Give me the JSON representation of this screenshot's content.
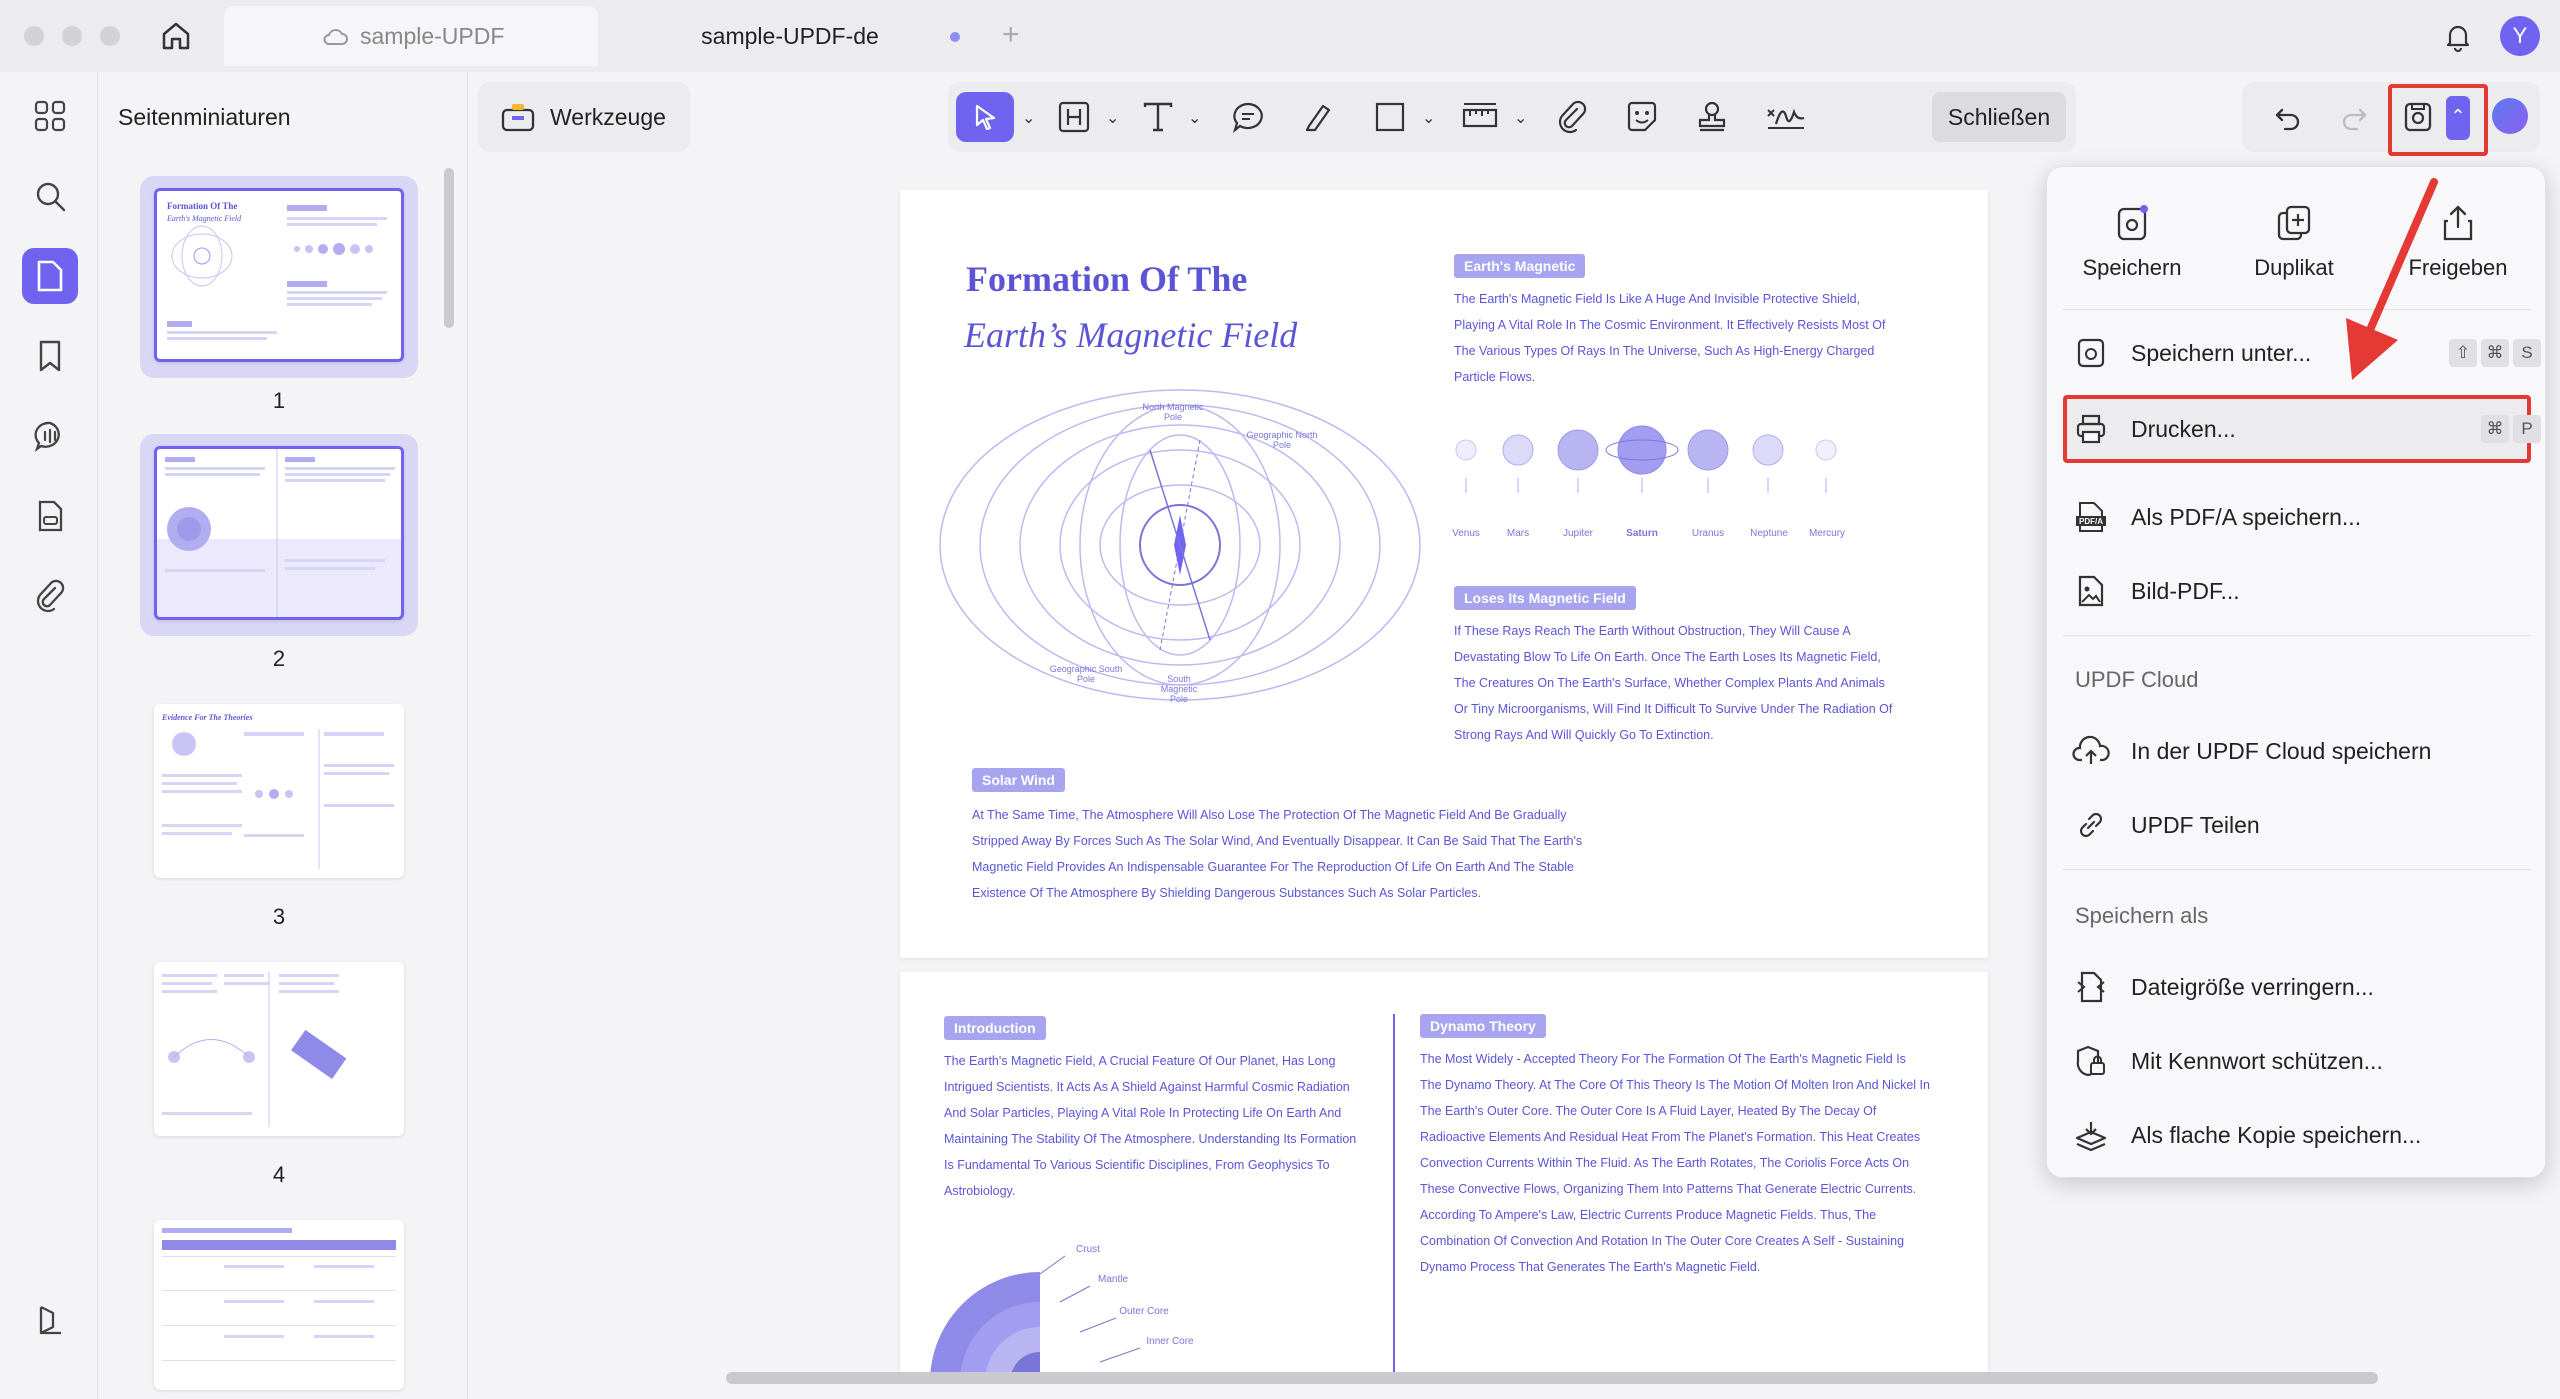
{
  "window": {
    "tabs": [
      {
        "label": "sample-UPDF"
      },
      {
        "label": "sample-UPDF-de"
      }
    ],
    "avatar_letter": "Y"
  },
  "sidebar": {
    "title": "Seitenminiaturen",
    "pages": [
      "1",
      "2",
      "3",
      "4"
    ]
  },
  "toolbar": {
    "werkzeuge_label": "Werkzeuge",
    "close_label": "Schließen"
  },
  "document": {
    "page1": {
      "title_line1": "Formation Of The",
      "title_line2": "Earth’s Magnetic Field",
      "badge_magnetic": "Earth's Magnetic",
      "magnetic_text": "The Earth's Magnetic Field Is Like A Huge And Invisible Protective Shield, Playing A Vital Role In The Cosmic Environment. It Effectively Resists Most Of The Various Types Of Rays In The Universe, Such As High-Energy Charged Particle Flows.",
      "planets": [
        "Venus",
        "Mars",
        "Jupiter",
        "Saturn",
        "Uranus",
        "Neptune",
        "Mercury"
      ],
      "badge_loses": "Loses Its Magnetic Field",
      "loses_text": "If These Rays Reach The Earth Without Obstruction, They Will Cause A Devastating Blow To Life On Earth. Once The Earth Loses Its Magnetic Field, The Creatures On The Earth's Surface, Whether Complex Plants And Animals Or Tiny Microorganisms, Will Find It Difficult To Survive Under The Radiation Of Strong Rays And Will Quickly Go To Extinction.",
      "badge_solar": "Solar Wind",
      "solar_text": "At The Same Time, The Atmosphere Will Also Lose The Protection Of The Magnetic Field And Be Gradually Stripped Away By Forces Such As The Solar Wind, And Eventually Disappear. It Can Be Said That The Earth's Magnetic Field Provides An Indispensable Guarantee For The Reproduction Of Life On Earth And The Stable Existence Of The Atmosphere By Shielding Dangerous Substances Such As Solar Particles.",
      "diagram_labels": {
        "north_magnetic": "North Magnetic Pole",
        "geo_north": "Geographic North Pole",
        "geo_south": "Geographic South Pole",
        "south_magnetic": "South Magnetic Pole"
      }
    },
    "page2": {
      "badge_intro": "Introduction",
      "intro_text": "The Earth's Magnetic Field, A Crucial Feature Of Our Planet, Has Long Intrigued Scientists. It Acts As A Shield Against Harmful Cosmic Radiation And Solar Particles, Playing A Vital Role In Protecting Life On Earth And Maintaining The Stability Of The Atmosphere. Understanding Its Formation Is Fundamental To Various Scientific Disciplines, From Geophysics To Astrobiology.",
      "badge_dynamo": "Dynamo Theory",
      "dynamo_text": "The Most Widely - Accepted Theory For The Formation Of The Earth's Magnetic Field Is The Dynamo Theory. At The Core Of This Theory Is The Motion Of Molten Iron And Nickel In The Earth's Outer Core. The Outer Core Is A Fluid Layer, Heated By The Decay Of Radioactive Elements And Residual Heat From The Planet's Formation. This Heat Creates Convection Currents Within The Fluid. As The Earth Rotates, The Coriolis Force Acts On These Convective Flows, Organizing Them Into Patterns That Generate Electric Currents. According To Ampere's Law, Electric Currents Produce Magnetic Fields. Thus, The Combination Of Convection And Rotation In The Outer Core Creates A Self - Sustaining Dynamo Process That Generates The Earth's Magnetic Field.",
      "layers": [
        "Crust",
        "Mantle",
        "Outer Core",
        "Inner Core"
      ]
    }
  },
  "menu": {
    "top_actions": [
      {
        "label": "Speichern",
        "icon": "save-icon"
      },
      {
        "label": "Duplikat",
        "icon": "duplicate-icon"
      },
      {
        "label": "Freigeben",
        "icon": "share-icon"
      }
    ],
    "items": {
      "save_as": {
        "label": "Speichern unter...",
        "keys": [
          "⇧",
          "⌘",
          "S"
        ]
      },
      "print": {
        "label": "Drucken...",
        "keys": [
          "⌘",
          "P"
        ]
      },
      "save_pdfa": {
        "label": "Als PDF/A speichern..."
      },
      "image_pdf": {
        "label": "Bild-PDF..."
      }
    },
    "cloud_section": "UPDF Cloud",
    "cloud_items": {
      "save_cloud": "In der UPDF Cloud speichern",
      "share": "UPDF Teilen"
    },
    "saveas_section": "Speichern als",
    "saveas_items": {
      "reduce": "Dateigröße verringern...",
      "password": "Mit Kennwort schützen...",
      "flatten": "Als flache Kopie speichern..."
    }
  }
}
